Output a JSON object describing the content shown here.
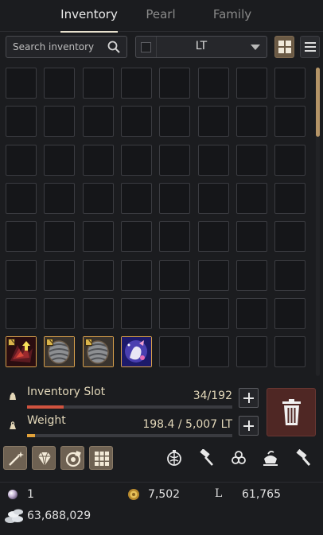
{
  "tabs": [
    {
      "label": "Inventory",
      "active": true
    },
    {
      "label": "Pearl",
      "active": false
    },
    {
      "label": "Family",
      "active": false
    }
  ],
  "search": {
    "placeholder": "Search inventory"
  },
  "filter": {
    "selected": "LT"
  },
  "colors": {
    "accent": "#b49467",
    "slot_fill": "#d0533f",
    "weight_fill": "#e2a23a",
    "item_border": "#d8a04b",
    "trash_bg": "#4f2724"
  },
  "grid": {
    "columns": 8,
    "rows": 8,
    "items": [
      {
        "slot": 56,
        "icon": "dark-weapon-icon",
        "upgrade_badge": true,
        "upgrade_arrow": true
      },
      {
        "slot": 57,
        "icon": "grey-armor-icon",
        "upgrade_badge": true,
        "upgrade_arrow": false
      },
      {
        "slot": 58,
        "icon": "grey-armor-icon",
        "upgrade_badge": true,
        "upgrade_arrow": false
      },
      {
        "slot": 59,
        "icon": "mystic-creature-icon",
        "upgrade_badge": false,
        "upgrade_arrow": false
      }
    ]
  },
  "inventory_slot": {
    "label": "Inventory Slot",
    "value": "34/192",
    "fill_fraction": 0.177
  },
  "weight": {
    "label": "Weight",
    "value": "198.4 / 5,007 LT",
    "fill_fraction": 0.04
  },
  "tool_icons": [
    "magic-wand-icon",
    "crystal-icon",
    "alchemy-stone-icon",
    "grid-manage-icon",
    "lantern-icon",
    "hammer-icon",
    "triskelion-icon",
    "pot-icon",
    "hammer-repair-icon"
  ],
  "currency": {
    "pearls": "1",
    "gold_bars": "7,502",
    "loyalty": "61,765",
    "loyalty_symbol": "L",
    "silver": "63,688,029"
  }
}
